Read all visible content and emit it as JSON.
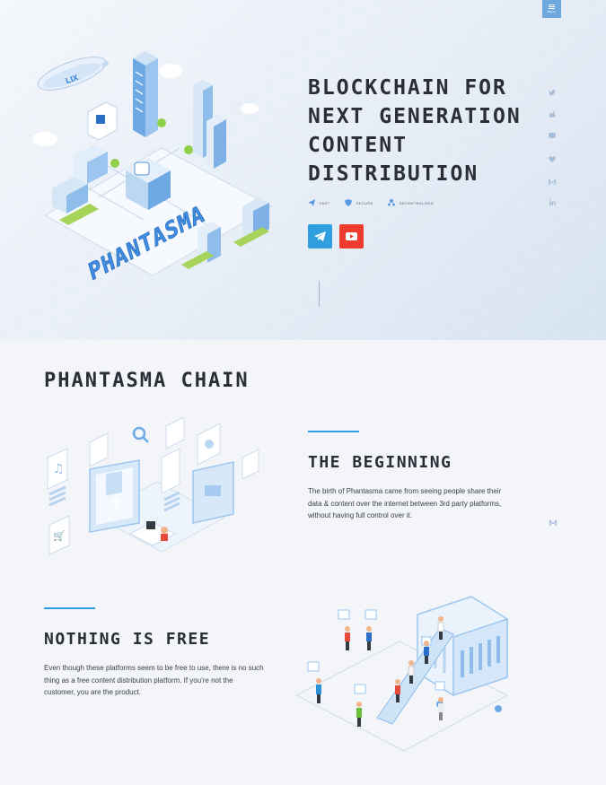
{
  "nav": {
    "menu_label": "MENU"
  },
  "hero": {
    "title": "BLOCKCHAIN FOR NEXT GENERATION CONTENT DISTRIBUTION",
    "illustration_label": "PHANTASMA",
    "blimp_label": "LIX",
    "features": [
      {
        "icon": "paper-plane-icon",
        "label": "FAST"
      },
      {
        "icon": "shield-icon",
        "label": "SECURE"
      },
      {
        "icon": "network-icon",
        "label": "DECENTRALIZED"
      }
    ],
    "buttons": [
      {
        "icon": "telegram-icon",
        "color": "#2f9fe0"
      },
      {
        "icon": "youtube-icon",
        "color": "#ef3b2d"
      }
    ]
  },
  "social": [
    "twitter-icon",
    "reddit-icon",
    "discord-icon",
    "telegram-icon",
    "medium-icon",
    "linkedin-icon"
  ],
  "sections": {
    "heading": "PHANTASMA CHAIN",
    "beginning": {
      "title": "THE BEGINNING",
      "text": "The birth of Phantasma came from seeing people share their data & content over the internet between 3rd party platforms, without having full control over it."
    },
    "free": {
      "title": "NOTHING IS FREE",
      "text": "Even though these platforms seem to be free to use, there is no such thing as a free content distribution platform. If you're not the customer, you are the product."
    }
  },
  "colors": {
    "accent": "#2d9fe2",
    "telegram": "#2f9fe0",
    "youtube": "#ef3b2d",
    "menu": "#6ea8de"
  }
}
